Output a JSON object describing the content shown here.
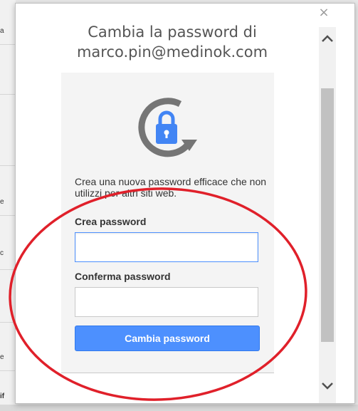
{
  "background": {
    "fragments": [
      "a",
      "e",
      "c",
      "e",
      "if"
    ]
  },
  "dialog": {
    "close_symbol": "×",
    "title_line1": "Cambia la password di",
    "title_line2": "marco.pin@medinok.com",
    "icon": "lock-refresh-icon",
    "description": "Crea una nuova password efficace che non utilizzi per altri siti web.",
    "create_label": "Crea password",
    "create_value": "",
    "confirm_label": "Conferma password",
    "confirm_value": "",
    "submit_label": "Cambia password"
  },
  "colors": {
    "accent": "#4d90fe",
    "annotation": "#e0202a",
    "lock": "#4285f4",
    "arrow": "#757575"
  }
}
